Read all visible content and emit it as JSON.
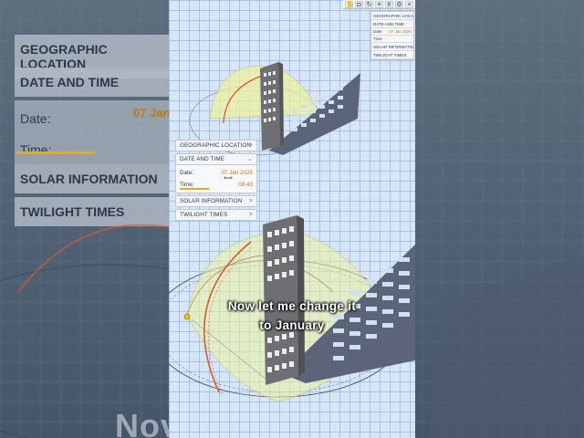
{
  "background_panel": {
    "geographic_location": "GEOGRAPHIC LOCATION",
    "date_and_time": "DATE AND TIME",
    "date_label": "Date:",
    "date_value": "07 Jan",
    "time_label": "Time:",
    "solar_information": "SOLAR INFORMATION",
    "twilight_times": "TWILIGHT TIMES",
    "big_caption": "Nov                e it"
  },
  "toolbar": {
    "icons": [
      "hand-icon",
      "camera-icon",
      "rotate-icon",
      "layers-icon",
      "grid-icon",
      "settings-icon",
      "close-icon"
    ]
  },
  "mini_panel": {
    "geographic_location": "GEOGRAPHIC LOCATION",
    "date_and_time": "DATE AND TIME",
    "date_label": "Date",
    "date_value": "07 Jan 2025",
    "time_label": "Time",
    "solar_information": "SOLAR INFORMATION",
    "twilight_times": "TWILIGHT TIMES"
  },
  "panel": {
    "geographic_location": "GEOGRAPHIC LOCATION",
    "date_and_time": "DATE AND TIME",
    "date_label": "Date:",
    "date_value": "07 Jan 2025",
    "time_label": "Time:",
    "time_value": "09:43",
    "time_progress": 0.4,
    "solar_information": "SOLAR INFORMATION",
    "twilight_times": "TWILIGHT TIMES",
    "chevron": ">",
    "chevron_open": "⌄",
    "arrow_ctrl": "⟺"
  },
  "caption": {
    "line1": "Now let me change it",
    "line2": "to January"
  },
  "colors": {
    "accent": "#c07a12",
    "sun_path": "#d9532a",
    "dome": "#e9ef9a",
    "shadow": "#5b6478",
    "building": "#6f6f73"
  }
}
